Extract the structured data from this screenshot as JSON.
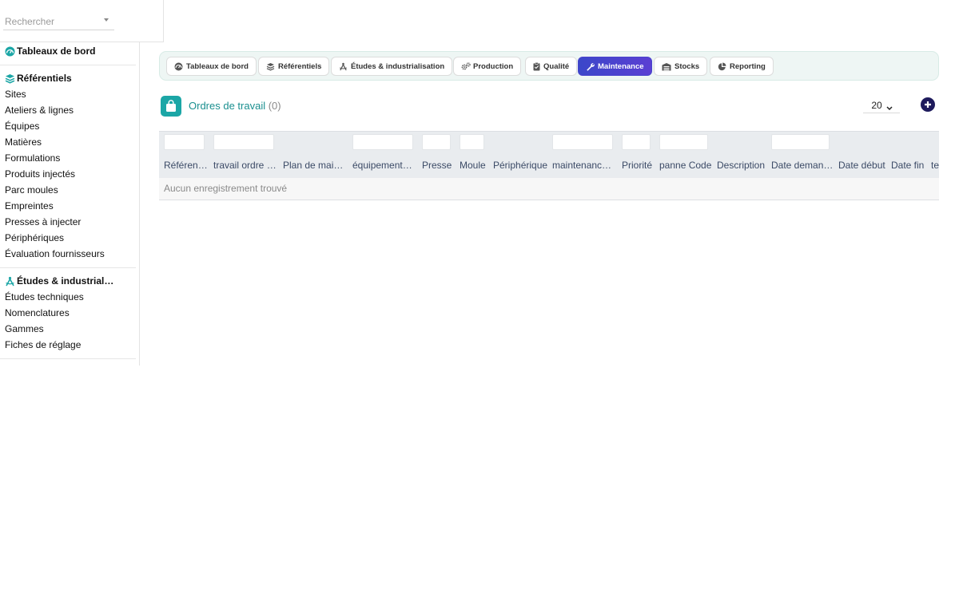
{
  "search": {
    "placeholder": "Rechercher"
  },
  "sidebar": {
    "dashboards": {
      "label": "Tableaux de bord"
    },
    "referentiels": {
      "label": "Référentiels",
      "items": [
        "Sites",
        "Ateliers & lignes",
        "Équipes",
        "Matières",
        "Formulations",
        "Produits injectés",
        "Parc moules",
        "Empreintes",
        "Presses à injecter",
        "Périphériques",
        "Évaluation fournisseurs"
      ]
    },
    "etudes": {
      "label": "Études & industrialis…",
      "items": [
        "Études techniques",
        "Nomenclatures",
        "Gammes",
        "Fiches de réglage"
      ]
    }
  },
  "tabs": [
    {
      "label": "Tableaux de bord",
      "icon": "dashboard-icon",
      "active": false
    },
    {
      "label": "Référentiels",
      "icon": "layers-icon",
      "active": false
    },
    {
      "label": "Études & industrialisation",
      "icon": "compass-icon",
      "active": false
    },
    {
      "label": "Production",
      "icon": "gears-icon",
      "active": false
    },
    {
      "label": "Qualité",
      "icon": "clipboard-check-icon",
      "active": false
    },
    {
      "label": "Maintenance",
      "icon": "wrench-icon",
      "active": true
    },
    {
      "label": "Stocks",
      "icon": "warehouse-icon",
      "active": false
    },
    {
      "label": "Reporting",
      "icon": "pie-chart-icon",
      "active": false
    }
  ],
  "section": {
    "title": "Ordres de travail",
    "count": "(0)",
    "icon": "shopping-bag-icon"
  },
  "page_size": "20",
  "grid": {
    "columns": [
      "Référence",
      "travail ordre …",
      "Plan de mai…",
      "équipement …",
      "Presse",
      "Moule",
      "Périphérique",
      "maintenance…",
      "Priorité",
      "panne Code",
      "Description",
      "Date demande",
      "Date début",
      "Date fin",
      "te"
    ],
    "empty_message": "Aucun enregistrement trouvé"
  },
  "colors": {
    "accent_teal": "#1ba6a6",
    "active_tab": "#4a44cc",
    "add_button": "#1e1b5c"
  }
}
